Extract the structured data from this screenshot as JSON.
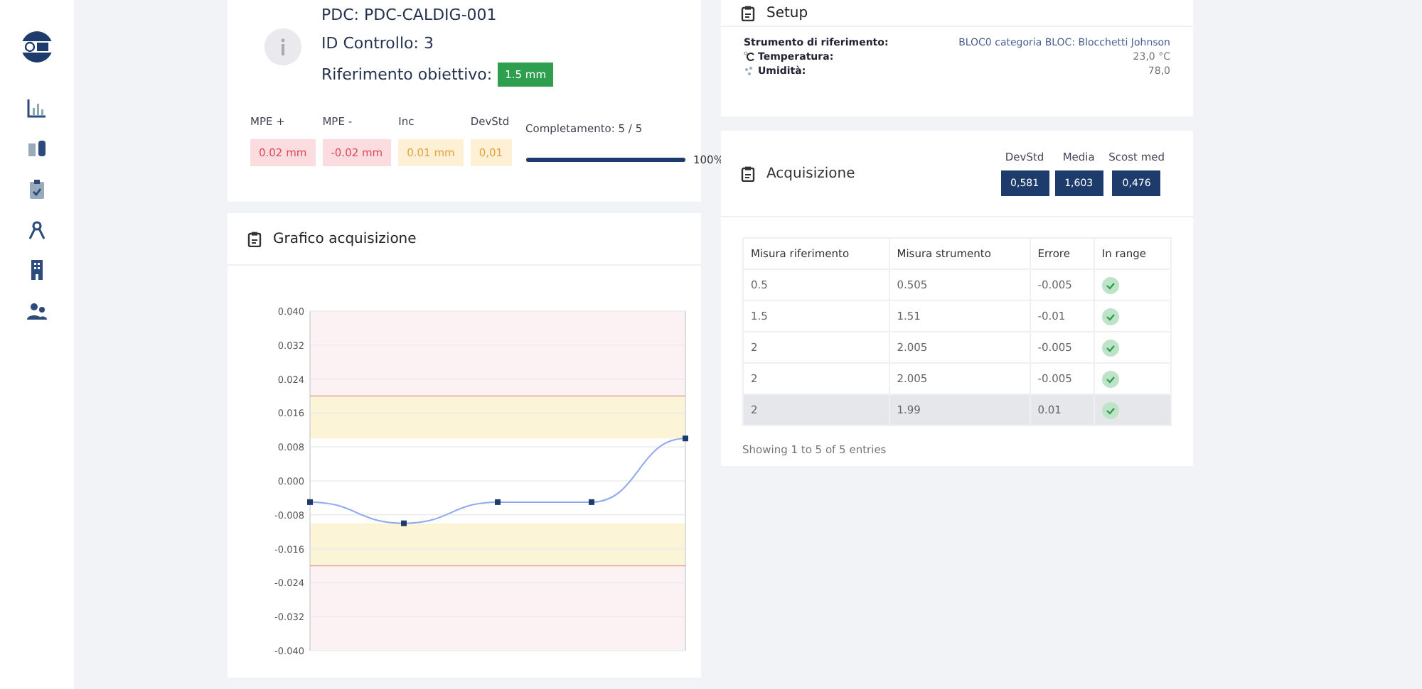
{
  "sidebar": {
    "items": [
      {
        "selected": false
      },
      {
        "selected": false
      },
      {
        "selected": false
      },
      {
        "selected": false
      },
      {
        "selected": false
      },
      {
        "selected": false
      }
    ]
  },
  "control": {
    "pdc": "PDC: PDC-CALDIG-001",
    "id": "ID Controllo: 3",
    "target_label": "Riferimento obiettivo:",
    "target_value": "1.5 mm",
    "stats": [
      {
        "label": "MPE +",
        "value": "0.02 mm",
        "kind": "danger"
      },
      {
        "label": "MPE -",
        "value": "-0.02 mm",
        "kind": "danger"
      },
      {
        "label": "Inc",
        "value": "0.01 mm",
        "kind": "warning"
      },
      {
        "label": "DevStd",
        "value": "0,01",
        "kind": "warning"
      }
    ],
    "progress": {
      "label": "Completamento: 5 / 5",
      "level": 1,
      "reading": "100%"
    }
  },
  "setup": {
    "title": "Setup",
    "rows": [
      {
        "label": "Strumento di riferimento:",
        "value": "BLOC0 categoria BLOC: Blocchetti Johnson",
        "kind": "link"
      },
      {
        "label": "Temperatura:",
        "value": "23,0 °C",
        "kind": "temperature"
      },
      {
        "label": "Umidità:",
        "value": "78,0",
        "kind": "humidity"
      }
    ]
  },
  "chart_card": {
    "title": "Grafico acquisizione",
    "chart_data": {
      "type": "line",
      "grid": true,
      "ylim": [
        -0.04,
        0.04
      ],
      "yticks": [
        {
          "value": 0.04,
          "label": "0.040"
        },
        {
          "value": 0.032,
          "label": "0.032"
        },
        {
          "value": 0.024,
          "label": "0.024"
        },
        {
          "value": 0.016,
          "label": "0.016"
        },
        {
          "value": 0.008,
          "label": "0.008"
        },
        {
          "value": 0,
          "label": "0.000"
        },
        {
          "value": -0.008,
          "label": "-0.008"
        },
        {
          "value": -0.016,
          "label": "-0.016"
        },
        {
          "value": -0.024,
          "label": "-0.024"
        },
        {
          "value": -0.032,
          "label": "-0.032"
        },
        {
          "value": -0.04,
          "label": "-0.040"
        }
      ],
      "series": [
        {
          "color": "#8fa8f0",
          "marker": "square",
          "values": [
            -0.005,
            -0.01,
            -0.005,
            -0.005,
            0.01
          ]
        }
      ],
      "bands": [
        {
          "axis": "y",
          "from": 0.02,
          "to": 0.04,
          "color": "#fdf2f3"
        },
        {
          "axis": "y",
          "from": 0.01,
          "to": 0.02,
          "color": "#fcf4d6"
        },
        {
          "axis": "y",
          "from": -0.02,
          "to": -0.01,
          "color": "#fcf4d6"
        },
        {
          "axis": "y",
          "from": -0.04,
          "to": -0.02,
          "color": "#fdf2f3"
        }
      ],
      "ref_lines": [
        {
          "axis": "y",
          "value": 0.02,
          "color": "#d9a99a"
        },
        {
          "axis": "y",
          "value": -0.02,
          "color": "#d9a99a"
        }
      ]
    }
  },
  "acquisition": {
    "title": "Acquisizione",
    "stats": [
      {
        "label": "DevStd",
        "value": "0,581"
      },
      {
        "label": "Media",
        "value": "1,603"
      },
      {
        "label": "Scost med",
        "value": "0,476"
      }
    ],
    "table": {
      "columns": [
        "Misura riferimento",
        "Misura strumento",
        "Errore",
        "In range"
      ],
      "rows": [
        {
          "cells": [
            "0.5",
            "0.505",
            "-0.005"
          ],
          "in_range": true,
          "selected": false
        },
        {
          "cells": [
            "1.5",
            "1.51",
            "-0.01"
          ],
          "in_range": true,
          "selected": false
        },
        {
          "cells": [
            "2",
            "2.005",
            "-0.005"
          ],
          "in_range": true,
          "selected": false
        },
        {
          "cells": [
            "2",
            "2.005",
            "-0.005"
          ],
          "in_range": true,
          "selected": false
        },
        {
          "cells": [
            "2",
            "1.99",
            "0.01"
          ],
          "in_range": true,
          "selected": true
        }
      ]
    },
    "footer": "Showing 1 to 5 of 5 entries"
  }
}
